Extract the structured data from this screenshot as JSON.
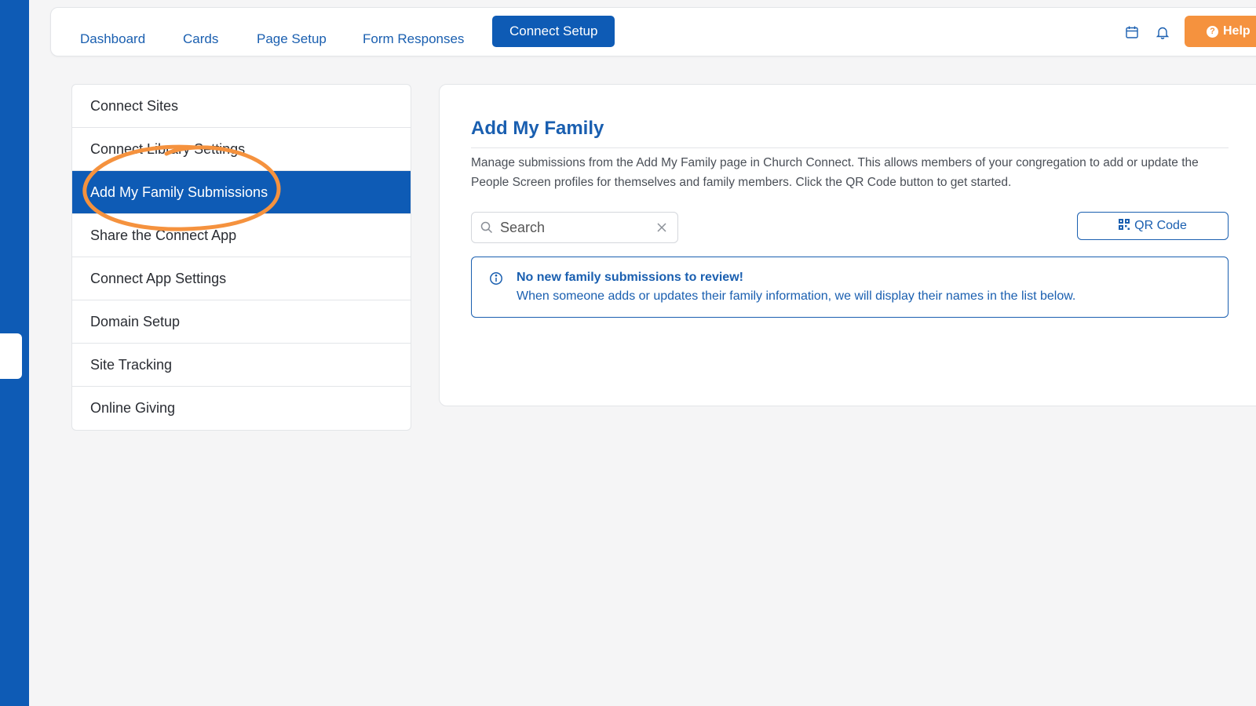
{
  "nav": {
    "dashboard": "Dashboard",
    "cards": "Cards",
    "page_setup": "Page Setup",
    "form_responses": "Form Responses",
    "connect_setup": "Connect Setup",
    "help": "Help",
    "icons": [
      "calendar-icon",
      "bell-icon"
    ]
  },
  "sidebar": {
    "items": [
      {
        "label": "Connect Sites"
      },
      {
        "label": "Connect Library Settings"
      },
      {
        "label": "Add My Family Submissions"
      },
      {
        "label": "Share the Connect App"
      },
      {
        "label": "Connect App Settings"
      },
      {
        "label": "Domain Setup"
      },
      {
        "label": "Site Tracking"
      },
      {
        "label": "Online Giving"
      }
    ],
    "active": "Add My Family Submissions"
  },
  "panel": {
    "title": "Add My Family",
    "description": "Manage submissions from the Add My Family page in Church Connect. This allows members of your congregation to add or update the People Screen profiles for themselves and family members. Click the QR Code button to get started.",
    "search": {
      "placeholder": "Search",
      "value": ""
    },
    "qr_button": "QR Code",
    "alert": {
      "title": "No new family submissions to review!",
      "body": "When someone adds or updates their family information, we will display their names in the list below."
    }
  },
  "colors": {
    "brand_blue": "#0e5bb5",
    "help_orange": "#f5923e",
    "highlight_ring": "#f5923e"
  }
}
